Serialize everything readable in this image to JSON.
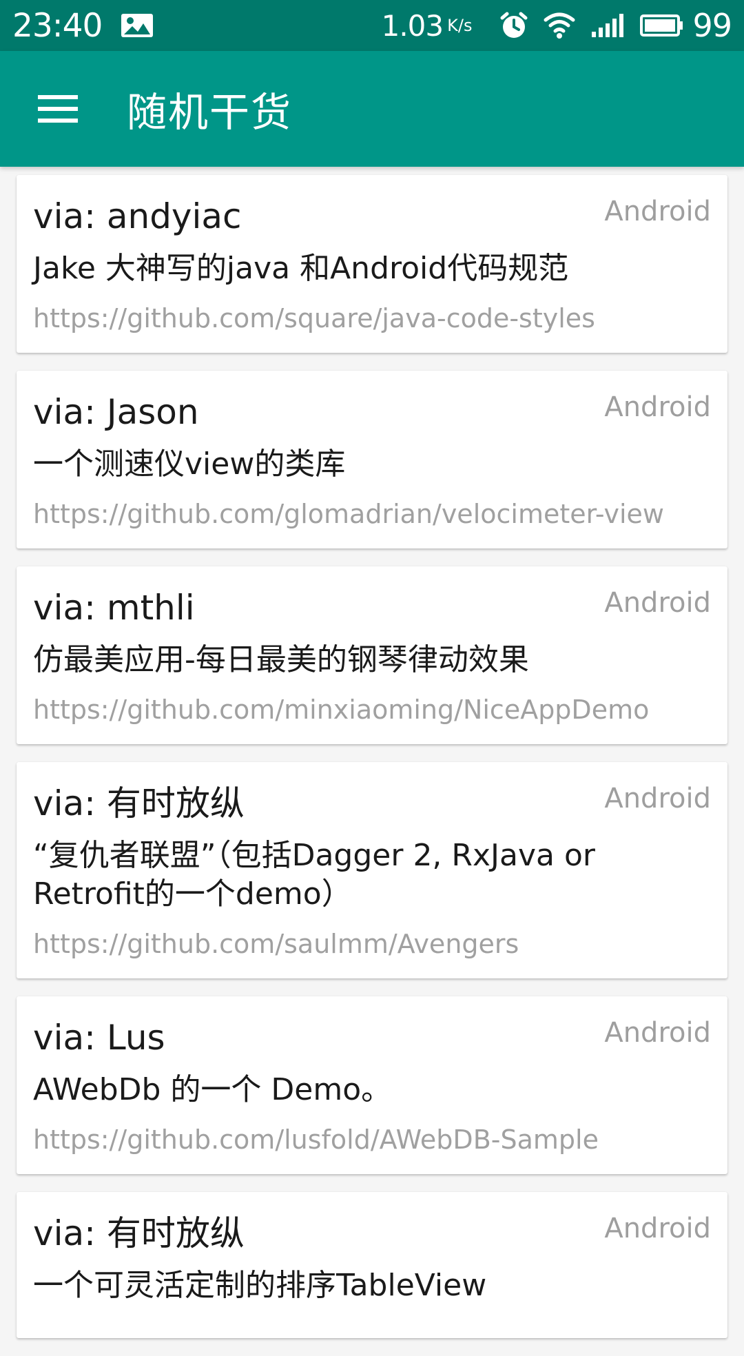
{
  "status_bar": {
    "time": "23:40",
    "net_speed": "1.03",
    "net_speed_unit": "K/s",
    "battery": "99",
    "image_icon": "image-icon",
    "alarm_icon": "alarm-icon",
    "wifi_icon": "wifi-icon",
    "signal_icon": "signal-icon",
    "battery_icon": "battery-icon"
  },
  "app_bar": {
    "title": "随机干货",
    "menu_icon": "menu-icon"
  },
  "colors": {
    "status_bar": "#00796B",
    "app_bar": "#009688",
    "background": "#F5F5F5",
    "card": "#FFFFFF",
    "secondary_text": "#9E9E9E"
  },
  "items": [
    {
      "who": "via: andyiac",
      "type": "Android",
      "desc": "Jake 大神写的java 和Android代码规范",
      "url": "https://github.com/square/java-code-styles"
    },
    {
      "who": "via: Jason",
      "type": "Android",
      "desc": "一个测速仪view的类库",
      "url": "https://github.com/glomadrian/velocimeter-view"
    },
    {
      "who": "via: mthli",
      "type": "Android",
      "desc": "仿最美应用-每日最美的钢琴律动效果",
      "url": "https://github.com/minxiaoming/NiceAppDemo"
    },
    {
      "who": "via: 有时放纵",
      "type": "Android",
      "desc": "“复仇者联盟”（包括Dagger 2, RxJava or Retrofit的一个demo）",
      "url": "https://github.com/saulmm/Avengers"
    },
    {
      "who": "via: Lus",
      "type": "Android",
      "desc": "AWebDb 的一个 Demo。",
      "url": "https://github.com/lusfold/AWebDB-Sample"
    },
    {
      "who": "via: 有时放纵",
      "type": "Android",
      "desc": "一个可灵活定制的排序TableView",
      "url": ""
    }
  ]
}
